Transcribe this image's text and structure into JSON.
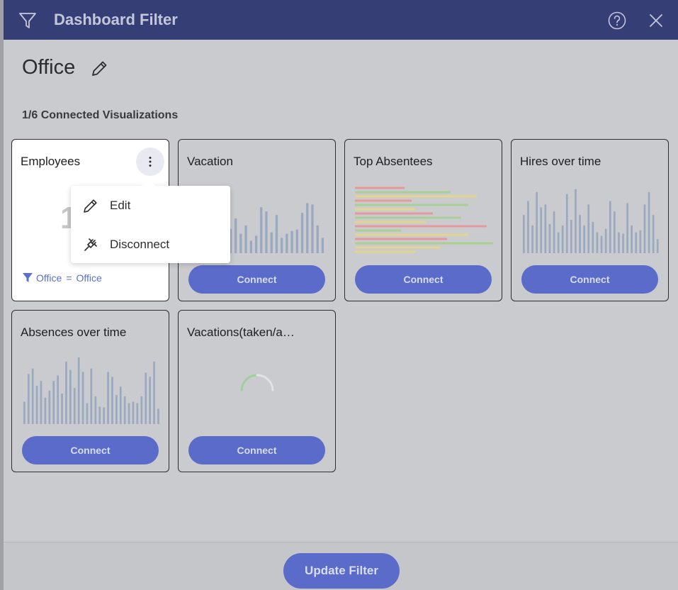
{
  "dialog": {
    "title": "Dashboard Filter",
    "filter_name": "Office",
    "connected_count": "1/6 Connected Visualizations",
    "update_button": "Update Filter"
  },
  "cards": [
    {
      "title": "Employees",
      "big_value": "1",
      "filter_field": "Office",
      "filter_operator": "=",
      "filter_value": "Office"
    },
    {
      "title": "Vacation",
      "button": "Connect"
    },
    {
      "title": "Top Absentees",
      "button": "Connect"
    },
    {
      "title": "Hires over time",
      "button": "Connect"
    },
    {
      "title": "Absences over time",
      "button": "Connect"
    },
    {
      "title": "Vacations(taken/a…",
      "button": "Connect"
    }
  ],
  "context_menu": {
    "items": [
      {
        "label": "Edit",
        "icon": "pencil-icon"
      },
      {
        "label": "Disconnect",
        "icon": "plug-icon"
      }
    ]
  },
  "colors": {
    "header": "#363e76",
    "accent": "#5a6bc9",
    "link": "#5a6fd6",
    "sparkline": "#9aa8c0"
  }
}
